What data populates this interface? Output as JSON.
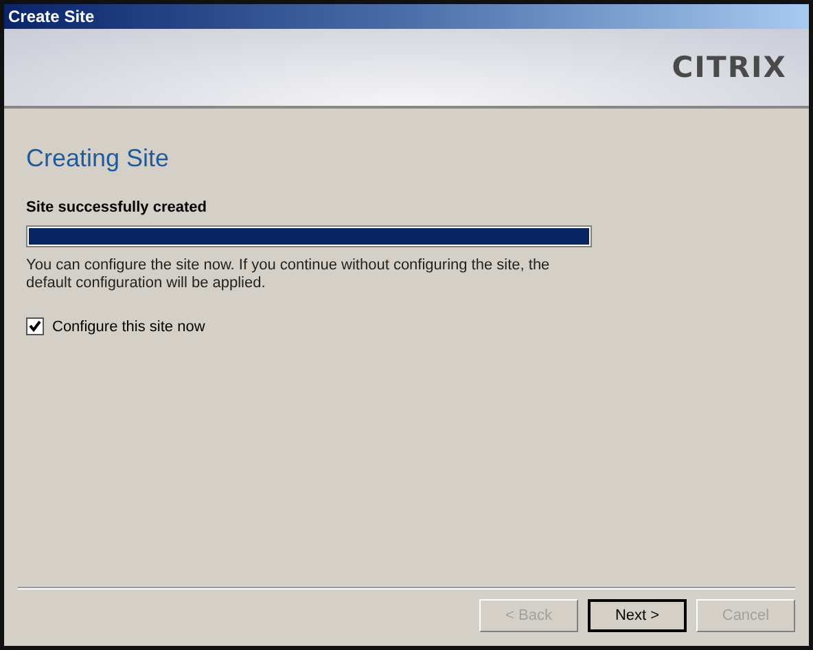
{
  "window": {
    "title": "Create Site"
  },
  "header": {
    "logo": "CITRIX"
  },
  "page": {
    "heading": "Creating Site",
    "status": "Site successfully created",
    "progress": {
      "level": 1
    },
    "description": "You can configure the site now. If you continue without configuring the site, the default configuration will be applied.",
    "checkbox": {
      "label": "Configure this site now",
      "checked": true
    }
  },
  "buttons": [
    {
      "label": "< Back",
      "disabled": true,
      "default": false
    },
    {
      "label": "Next >",
      "disabled": false,
      "default": true
    },
    {
      "label": "Cancel",
      "disabled": true,
      "default": false
    }
  ]
}
